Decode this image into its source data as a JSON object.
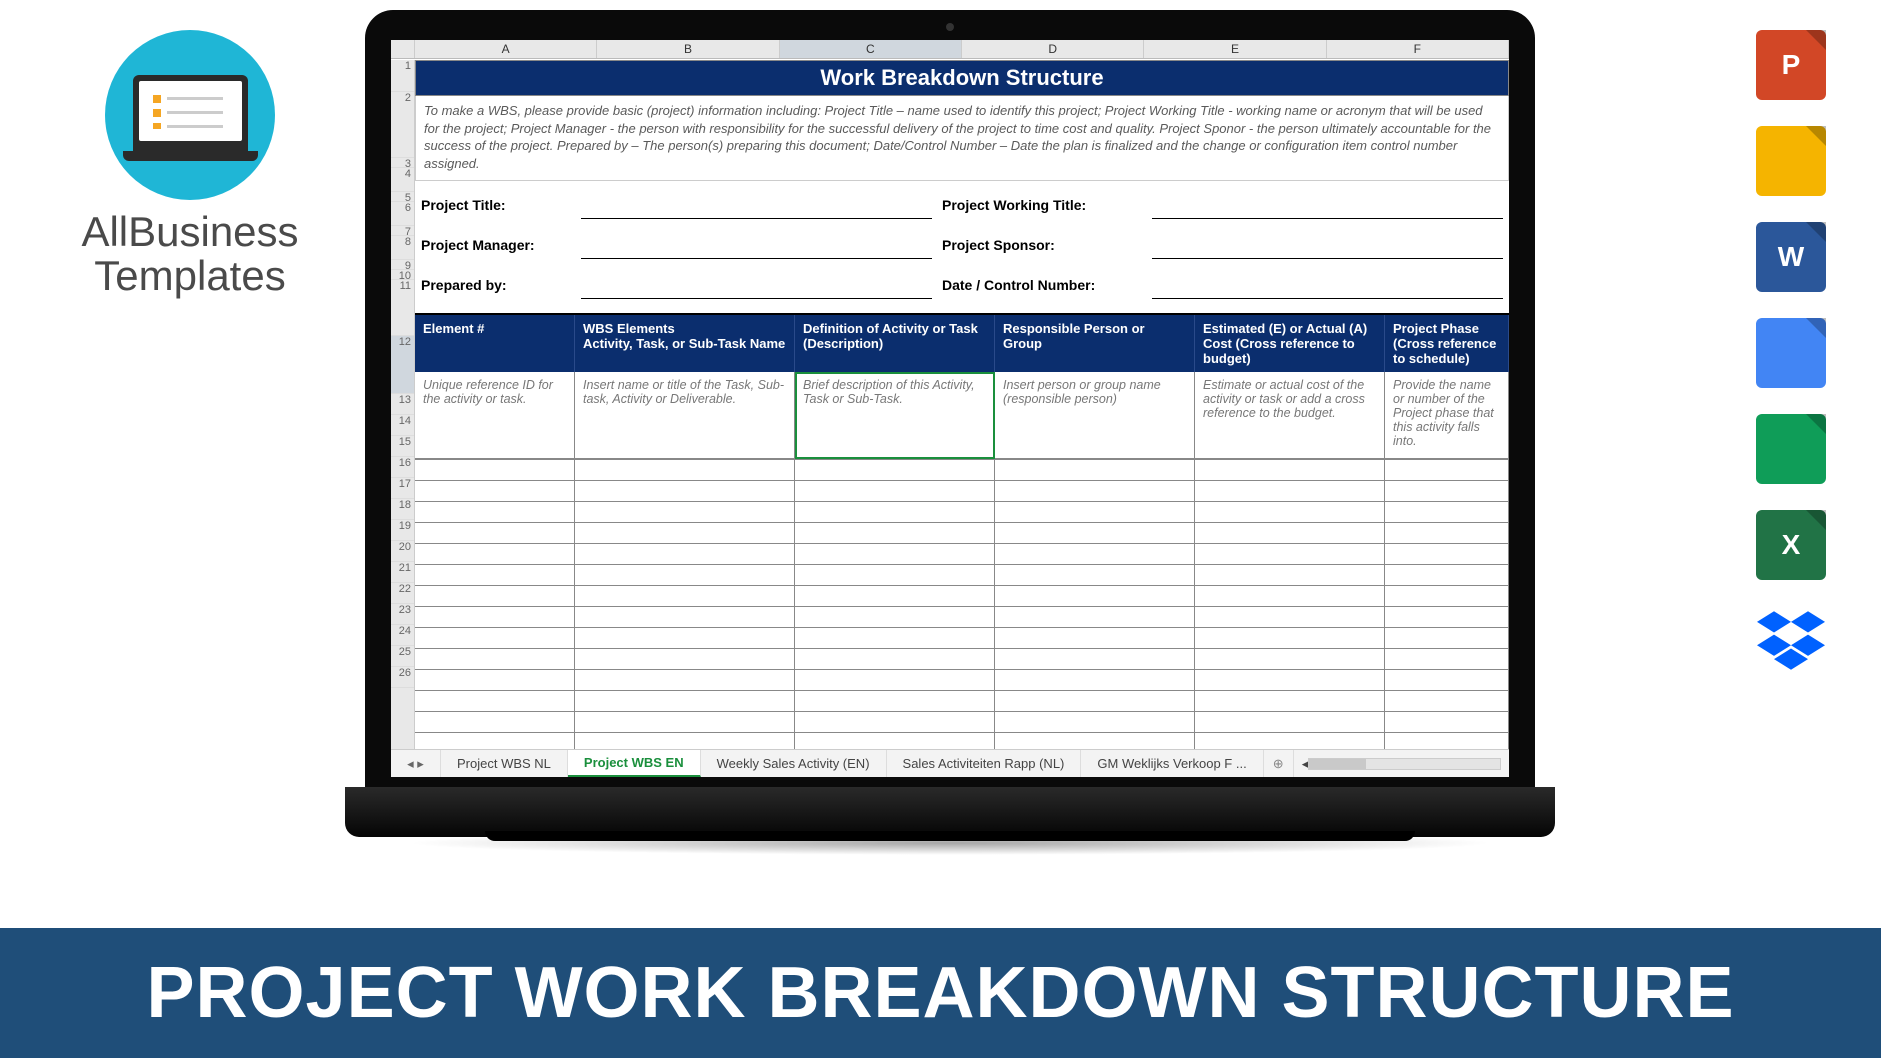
{
  "brand": {
    "line1": "AllBusiness",
    "line2": "Templates"
  },
  "file_icons": {
    "ppt": "P",
    "slides": "",
    "word": "W",
    "docs": "",
    "sheets": "",
    "excel": "X",
    "dropbox": ""
  },
  "banner": "PROJECT WORK BREAKDOWN STRUCTURE",
  "sheet": {
    "columns": [
      "A",
      "B",
      "C",
      "D",
      "E",
      "F"
    ],
    "title": "Work Breakdown Structure",
    "instructions": "To make a WBS, please provide basic (project) information including: Project Title – name used to identify this project; Project Working Title - working name or acronym that will be used for the project; Project Manager - the person with responsibility for the successful delivery of the project to time cost and quality. Project Sponor - the person ultimately accountable for the success of the project. Prepared by – The person(s) preparing this document; Date/Control Number – Date the plan is finalized and the change or configuration item control number assigned.",
    "meta": {
      "project_title_label": "Project Title:",
      "project_title_value": "",
      "project_working_title_label": "Project Working Title:",
      "project_working_title_value": "",
      "project_manager_label": "Project Manager:",
      "project_manager_value": "",
      "project_sponsor_label": "Project Sponsor:",
      "project_sponsor_value": "",
      "prepared_by_label": "Prepared by:",
      "prepared_by_value": "",
      "date_control_label": "Date / Control Number:",
      "date_control_value": ""
    },
    "headers": {
      "c0": "Element #",
      "c1": "WBS Elements\nActivity, Task, or Sub-Task Name",
      "c2": "Definition of Activity or Task (Description)",
      "c3": "Responsible Person or Group",
      "c4": "Estimated (E) or Actual (A) Cost (Cross reference to budget)",
      "c5": "Project Phase (Cross reference to schedule)"
    },
    "hints": {
      "c0": "Unique reference ID for the activity or task.",
      "c1": "Insert name or title of the Task, Sub-task, Activity or Deliverable.",
      "c2": "Brief description of this Activity, Task or Sub-Task.",
      "c3": "Insert person or group name (responsible person)",
      "c4": "Estimate or actual cost of the activity or task or add a cross reference to the budget.",
      "c5": "Provide the name or number of the Project phase that this activity falls into."
    },
    "row_numbers": [
      "1",
      "2",
      "3",
      "4",
      "5",
      "6",
      "7",
      "8",
      "9",
      "10",
      "11",
      "12",
      "13",
      "14",
      "15",
      "16",
      "17",
      "18",
      "19",
      "20",
      "21",
      "22",
      "23",
      "24",
      "25",
      "26"
    ],
    "tabs": {
      "t0": "Project WBS NL",
      "t1": "Project WBS EN",
      "t2": "Weekly Sales Activity (EN)",
      "t3": "Sales Activiteiten Rapp (NL)",
      "t4": "GM Weklijks Verkoop F ..."
    }
  }
}
